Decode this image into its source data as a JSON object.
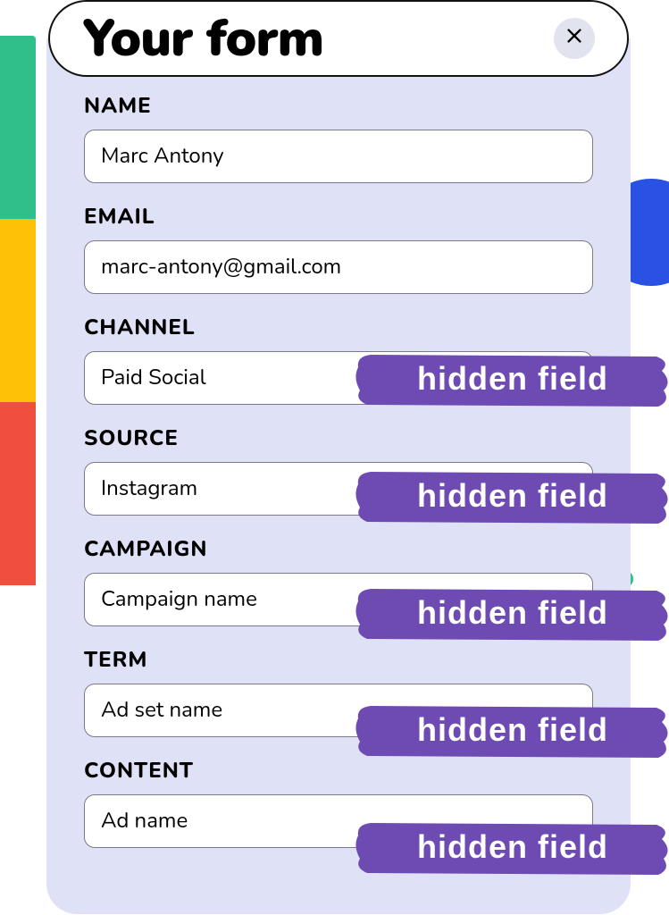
{
  "header": {
    "title": "Your form"
  },
  "badge_text": "hidden field",
  "fields": {
    "name": {
      "label": "NAME",
      "value": "Marc Antony"
    },
    "email": {
      "label": "EMAIL",
      "value": "marc-antony@gmail.com"
    },
    "channel": {
      "label": "CHANNEL",
      "value": "Paid Social"
    },
    "source": {
      "label": "SOURCE",
      "value": "Instagram"
    },
    "campaign": {
      "label": "CAMPAIGN",
      "value": "Campaign name"
    },
    "term": {
      "label": "TERM",
      "value": "Ad set name"
    },
    "content": {
      "label": "CONTENT",
      "value": "Ad name"
    }
  },
  "colors": {
    "card_bg": "#dfe1f6",
    "badge_purple": "#6e4bb2"
  }
}
